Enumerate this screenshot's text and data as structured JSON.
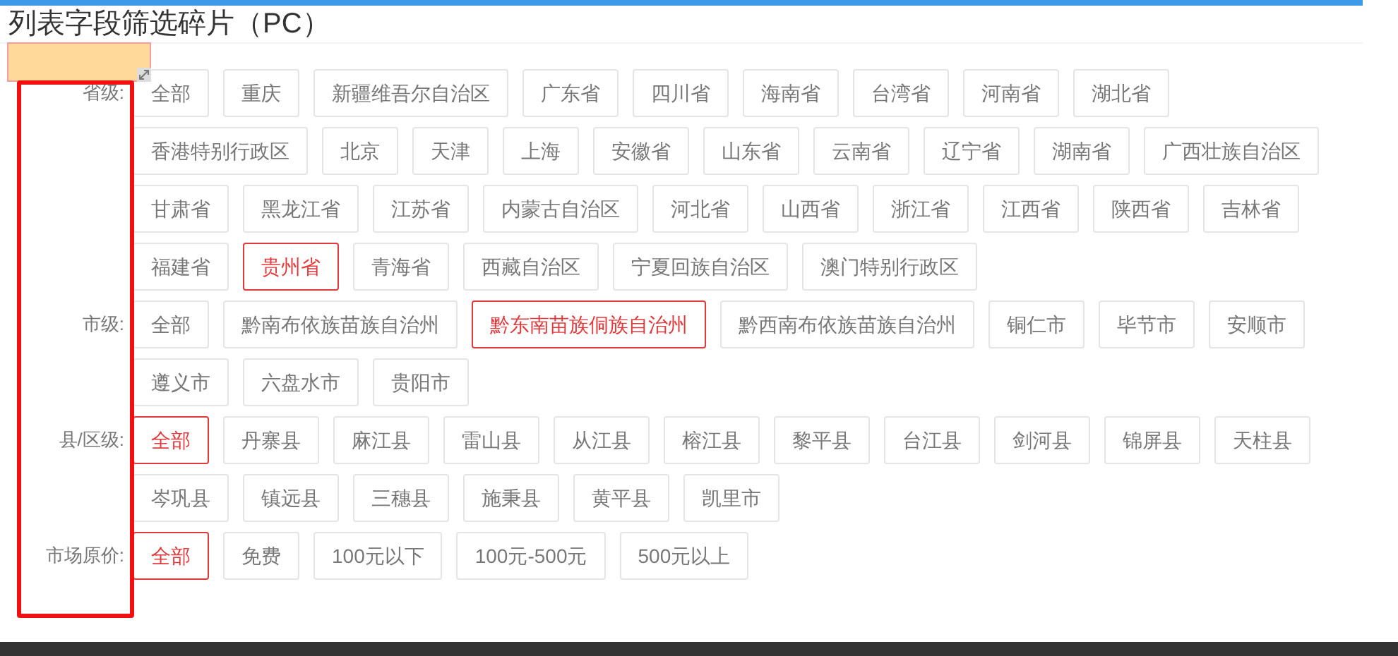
{
  "title": "列表字段筛选碎片（PC）",
  "filters": [
    {
      "label": "省级:",
      "options": [
        {
          "text": "全部",
          "selected": false
        },
        {
          "text": "重庆",
          "selected": false
        },
        {
          "text": "新疆维吾尔自治区",
          "selected": false
        },
        {
          "text": "广东省",
          "selected": false
        },
        {
          "text": "四川省",
          "selected": false
        },
        {
          "text": "海南省",
          "selected": false
        },
        {
          "text": "台湾省",
          "selected": false
        },
        {
          "text": "河南省",
          "selected": false
        },
        {
          "text": "湖北省",
          "selected": false
        },
        {
          "text": "香港特别行政区",
          "selected": false
        },
        {
          "text": "北京",
          "selected": false
        },
        {
          "text": "天津",
          "selected": false
        },
        {
          "text": "上海",
          "selected": false
        },
        {
          "text": "安徽省",
          "selected": false
        },
        {
          "text": "山东省",
          "selected": false
        },
        {
          "text": "云南省",
          "selected": false
        },
        {
          "text": "辽宁省",
          "selected": false
        },
        {
          "text": "湖南省",
          "selected": false
        },
        {
          "text": "广西壮族自治区",
          "selected": false
        },
        {
          "text": "甘肃省",
          "selected": false
        },
        {
          "text": "黑龙江省",
          "selected": false
        },
        {
          "text": "江苏省",
          "selected": false
        },
        {
          "text": "内蒙古自治区",
          "selected": false
        },
        {
          "text": "河北省",
          "selected": false
        },
        {
          "text": "山西省",
          "selected": false
        },
        {
          "text": "浙江省",
          "selected": false
        },
        {
          "text": "江西省",
          "selected": false
        },
        {
          "text": "陕西省",
          "selected": false
        },
        {
          "text": "吉林省",
          "selected": false
        },
        {
          "text": "福建省",
          "selected": false
        },
        {
          "text": "贵州省",
          "selected": true
        },
        {
          "text": "青海省",
          "selected": false
        },
        {
          "text": "西藏自治区",
          "selected": false
        },
        {
          "text": "宁夏回族自治区",
          "selected": false
        },
        {
          "text": "澳门特别行政区",
          "selected": false
        }
      ]
    },
    {
      "label": "市级:",
      "options": [
        {
          "text": "全部",
          "selected": false
        },
        {
          "text": "黔南布依族苗族自治州",
          "selected": false
        },
        {
          "text": "黔东南苗族侗族自治州",
          "selected": true
        },
        {
          "text": "黔西南布依族苗族自治州",
          "selected": false
        },
        {
          "text": "铜仁市",
          "selected": false
        },
        {
          "text": "毕节市",
          "selected": false
        },
        {
          "text": "安顺市",
          "selected": false
        },
        {
          "text": "遵义市",
          "selected": false
        },
        {
          "text": "六盘水市",
          "selected": false
        },
        {
          "text": "贵阳市",
          "selected": false
        }
      ]
    },
    {
      "label": "县/区级:",
      "options": [
        {
          "text": "全部",
          "selected": true
        },
        {
          "text": "丹寨县",
          "selected": false
        },
        {
          "text": "麻江县",
          "selected": false
        },
        {
          "text": "雷山县",
          "selected": false
        },
        {
          "text": "从江县",
          "selected": false
        },
        {
          "text": "榕江县",
          "selected": false
        },
        {
          "text": "黎平县",
          "selected": false
        },
        {
          "text": "台江县",
          "selected": false
        },
        {
          "text": "剑河县",
          "selected": false
        },
        {
          "text": "锦屏县",
          "selected": false
        },
        {
          "text": "天柱县",
          "selected": false
        },
        {
          "text": "岑巩县",
          "selected": false
        },
        {
          "text": "镇远县",
          "selected": false
        },
        {
          "text": "三穗县",
          "selected": false
        },
        {
          "text": "施秉县",
          "selected": false
        },
        {
          "text": "黄平县",
          "selected": false
        },
        {
          "text": "凯里市",
          "selected": false
        }
      ]
    },
    {
      "label": "市场原价:",
      "options": [
        {
          "text": "全部",
          "selected": true
        },
        {
          "text": "免费",
          "selected": false
        },
        {
          "text": "100元以下",
          "selected": false
        },
        {
          "text": "100元-500元",
          "selected": false
        },
        {
          "text": "500元以上",
          "selected": false
        }
      ]
    }
  ]
}
